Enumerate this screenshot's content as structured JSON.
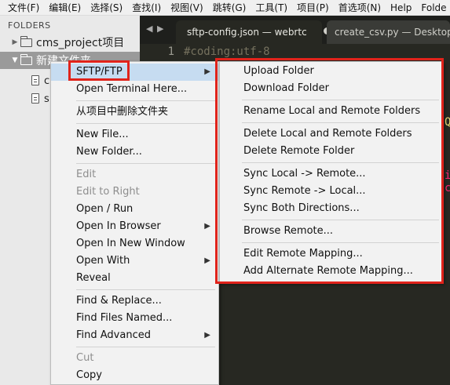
{
  "menubar": {
    "items": [
      "文件(F)",
      "编辑(E)",
      "选择(S)",
      "查找(I)",
      "视图(V)",
      "跳转(G)",
      "工具(T)",
      "项目(P)",
      "首选项(N)",
      "Help",
      "Folde"
    ]
  },
  "sidebar": {
    "header": "FOLDERS",
    "tree": [
      {
        "label": "cms_project项目",
        "type": "folder",
        "expanded": false
      },
      {
        "label": "新建文件夹",
        "type": "folder",
        "expanded": true,
        "selected": true
      },
      {
        "label": "c",
        "type": "file"
      },
      {
        "label": "s",
        "type": "file"
      }
    ]
  },
  "editor": {
    "tabs": [
      {
        "label": "sftp-config.json — webrtc",
        "active": true
      },
      {
        "label": "create_csv.py — Desktop",
        "active": false
      }
    ],
    "line_number": "1",
    "code_line": "#coding:utf-8",
    "edge_glyphs": [
      "Q",
      "i",
      "c"
    ]
  },
  "context_menu": {
    "items": [
      {
        "label": "SFTP/FTP",
        "submenu": true,
        "disabled": false,
        "highlight": true
      },
      {
        "label": "Open Terminal Here...",
        "submenu": false,
        "disabled": false
      },
      {
        "label": "从项目中删除文件夹",
        "submenu": false,
        "disabled": false
      },
      {
        "label": "New File...",
        "submenu": false,
        "disabled": false
      },
      {
        "label": "New Folder...",
        "submenu": false,
        "disabled": false
      },
      {
        "label": "Edit",
        "submenu": false,
        "disabled": true
      },
      {
        "label": "Edit to Right",
        "submenu": false,
        "disabled": true
      },
      {
        "label": "Open / Run",
        "submenu": false,
        "disabled": false
      },
      {
        "label": "Open In Browser",
        "submenu": true,
        "disabled": false
      },
      {
        "label": "Open In New Window",
        "submenu": false,
        "disabled": false
      },
      {
        "label": "Open With",
        "submenu": true,
        "disabled": false
      },
      {
        "label": "Reveal",
        "submenu": false,
        "disabled": false
      },
      {
        "label": "Find & Replace...",
        "submenu": false,
        "disabled": false
      },
      {
        "label": "Find Files Named...",
        "submenu": false,
        "disabled": false
      },
      {
        "label": "Find Advanced",
        "submenu": true,
        "disabled": false
      },
      {
        "label": "Cut",
        "submenu": false,
        "disabled": true
      },
      {
        "label": "Copy",
        "submenu": false,
        "disabled": false
      }
    ]
  },
  "sftp_submenu": {
    "items": [
      "Upload Folder",
      "Download Folder",
      "Rename Local and Remote Folders",
      "Delete Local and Remote Folders",
      "Delete Remote Folder",
      "Sync Local -> Remote...",
      "Sync Remote -> Local...",
      "Sync Both Directions...",
      "Browse Remote...",
      "Edit Remote Mapping...",
      "Add Alternate Remote Mapping..."
    ]
  },
  "colors": {
    "annotation": "#e0231b",
    "highlight": "#c6dcf1",
    "editor_bg": "#272822",
    "sidebar_bg": "#e9e9e9"
  }
}
